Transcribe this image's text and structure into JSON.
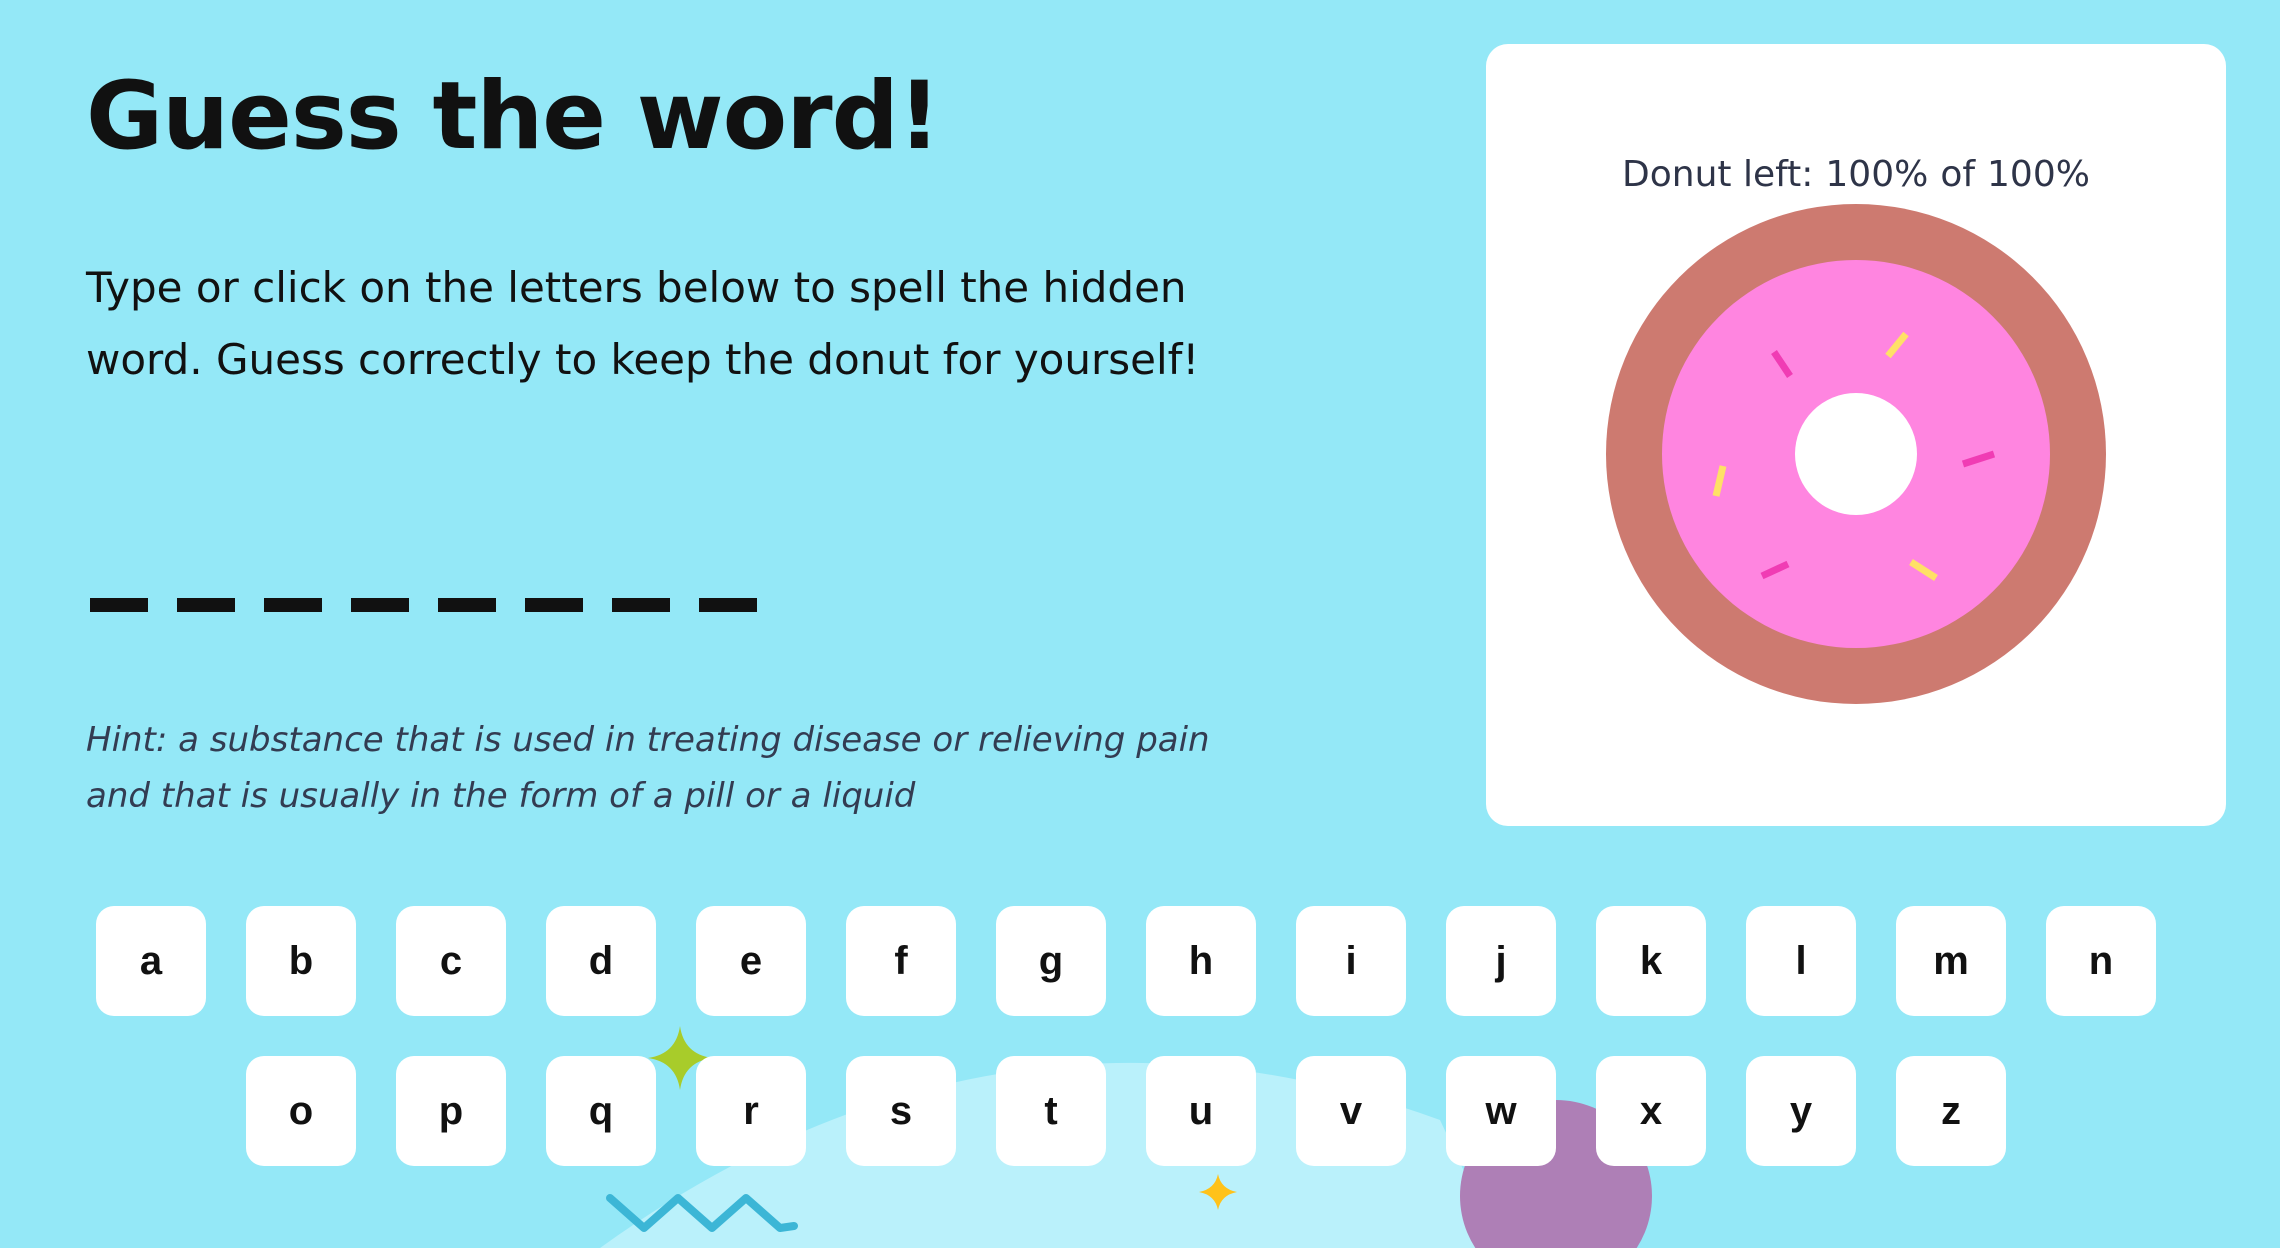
{
  "game": {
    "title": "Guess the word!",
    "instructions": "Type or click on the letters below to spell the hidden word. Guess correctly to keep the donut for yourself!",
    "blank_count": 8,
    "hint": "Hint: a substance that is used in treating disease or relieving pain and that is usually in the form of a pill or a liquid"
  },
  "donut_panel": {
    "label": "Donut left:",
    "remaining": "100%",
    "of_label": "of",
    "total": "100%",
    "fraction_remaining": 1.0
  },
  "keyboard": {
    "row1": [
      "a",
      "b",
      "c",
      "d",
      "e",
      "f",
      "g",
      "h",
      "i",
      "j",
      "k",
      "l",
      "m",
      "n"
    ],
    "row2": [
      "o",
      "p",
      "q",
      "r",
      "s",
      "t",
      "u",
      "v",
      "w",
      "x",
      "y",
      "z"
    ]
  },
  "colors": {
    "background": "#94e8f7",
    "donut_dough": "#cd7a70",
    "donut_icing": "#ff85e0",
    "sprinkle_pink": "#f03cb4",
    "sprinkle_yellow": "#ffe066",
    "hill": "#baf1fb",
    "purple_circle": "#ae7fb6",
    "green_star": "#a8cc2a",
    "yellow_star": "#ffc21a",
    "zigzag": "#3cb6d6"
  }
}
